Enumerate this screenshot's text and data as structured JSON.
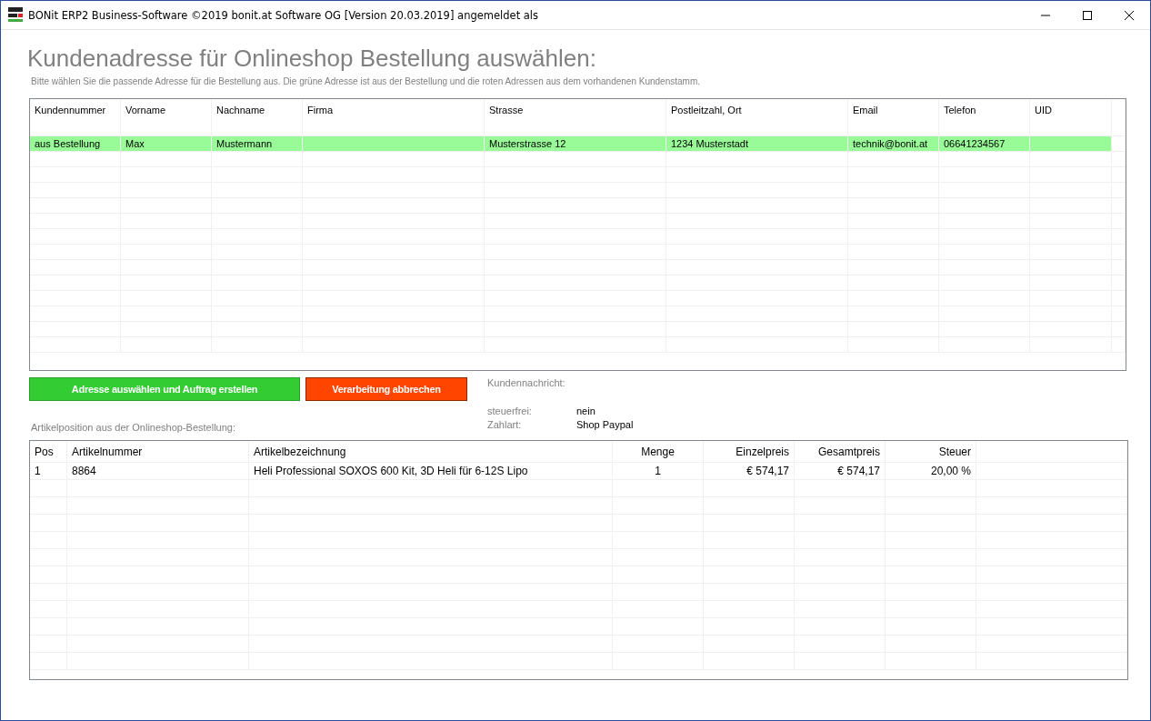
{
  "window": {
    "title": "BONit ERP2 Business-Software ©2019 bonit.at Software OG [Version 20.03.2019] angemeldet als"
  },
  "heading": "Kundenadresse für Onlineshop Bestellung auswählen:",
  "subtitle": "Bitte wählen Sie die passende Adresse für die Bestellung aus. Die grüne Adresse ist aus der Bestellung und die roten Adressen aus dem vorhandenen Kundenstamm.",
  "address_table": {
    "columns": [
      "Kundennummer",
      "Vorname",
      "Nachname",
      "Firma",
      "Strasse",
      "Postleitzahl, Ort",
      "Email",
      "Telefon",
      "UID"
    ],
    "rows": [
      {
        "color": "#98fb98",
        "cells": [
          "aus Bestellung",
          "Max",
          "Mustermann",
          "",
          "Musterstrasse 12",
          "1234 Musterstadt",
          "technik@bonit.at",
          "06641234567",
          ""
        ]
      }
    ]
  },
  "buttons": [
    {
      "label": "Adresse auswählen und Auftrag erstellen",
      "kind": "confirm"
    },
    {
      "label": "Verarbeitung abbrechen",
      "kind": "cancel"
    }
  ],
  "info": {
    "message_label": "Kundennachricht:",
    "fields": [
      {
        "label": "steuerfrei:",
        "value": "nein"
      },
      {
        "label": "Zahlart:",
        "value": "Shop Paypal"
      }
    ]
  },
  "items_label": "Artikelposition aus der Onlineshop-Bestellung:",
  "items_table": {
    "columns": [
      "Pos",
      "Artikelnummer",
      "Artikelbezeichnung",
      "Menge",
      "Einzelpreis",
      "Gesamtpreis",
      "Steuer"
    ],
    "rows": [
      [
        "1",
        "8864",
        "Heli Professional SOXOS 600 Kit, 3D Heli für 6-12S Lipo",
        "1",
        "€ 574,17",
        "€ 574,17",
        "20,00 %"
      ]
    ]
  }
}
